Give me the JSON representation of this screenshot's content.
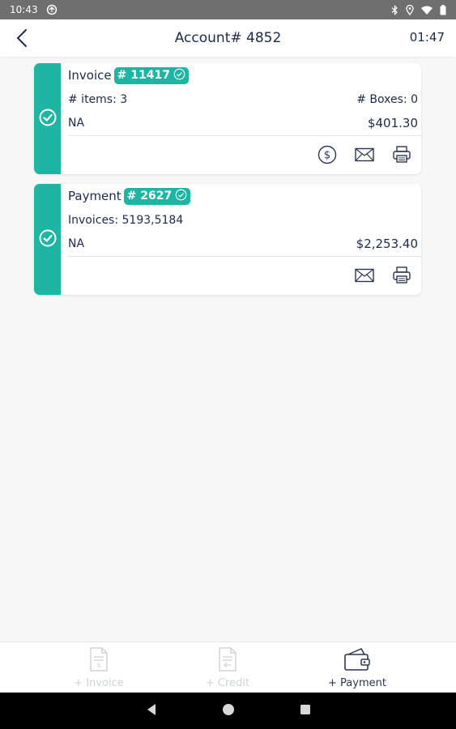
{
  "status_bar": {
    "time": "10:43"
  },
  "app_bar": {
    "title": "Account# 4852",
    "timer": "01:47"
  },
  "cards": [
    {
      "type_label": "Invoice",
      "number_badge": "# 11417",
      "left_label": "# items:  3",
      "right_label": "# Boxes: 0",
      "note": "NA",
      "amount": "$401.30"
    },
    {
      "type_label": "Payment",
      "number_badge": "# 2627",
      "left_label": "Invoices: 5193,5184",
      "note": "NA",
      "amount": "$2,253.40"
    }
  ],
  "bottom_nav": {
    "items": [
      {
        "label": "+ Invoice",
        "state": "disabled",
        "icon": "invoice-document-icon"
      },
      {
        "label": "+ Credit",
        "state": "disabled",
        "icon": "credit-document-icon"
      },
      {
        "label": "+ Payment",
        "state": "active",
        "icon": "wallet-icon"
      }
    ]
  },
  "colors": {
    "accent": "#1fb5a3",
    "text": "#1d2a4a",
    "status_bar": "#6f6f6f",
    "background": "#f7f7f8"
  }
}
